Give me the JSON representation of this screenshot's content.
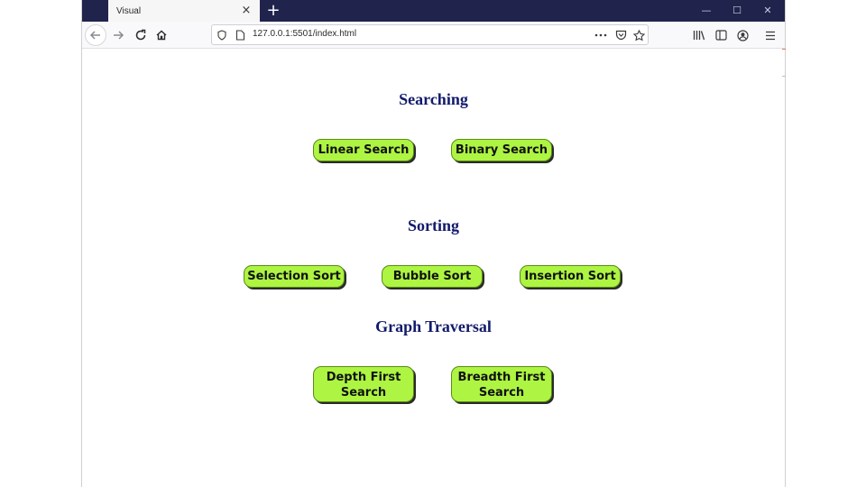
{
  "browser": {
    "tab_title": "Visual",
    "tab_close": "×",
    "new_tab": "+",
    "url": "127.0.0.1:5501/index.html",
    "window_controls": {
      "minimize": "—",
      "maximize": "☐",
      "close": "✕"
    },
    "theme_color": "#20234c"
  },
  "page": {
    "sections": [
      {
        "heading": "Searching",
        "buttons": [
          "Linear Search",
          "Binary Search"
        ]
      },
      {
        "heading": "Sorting",
        "buttons": [
          "Selection Sort",
          "Bubble Sort",
          "Insertion Sort"
        ]
      },
      {
        "heading": "Graph Traversal",
        "buttons": [
          "Depth First Search",
          "Breadth First Search"
        ]
      }
    ],
    "button_color": "#adf542",
    "heading_color": "#111a6b"
  }
}
